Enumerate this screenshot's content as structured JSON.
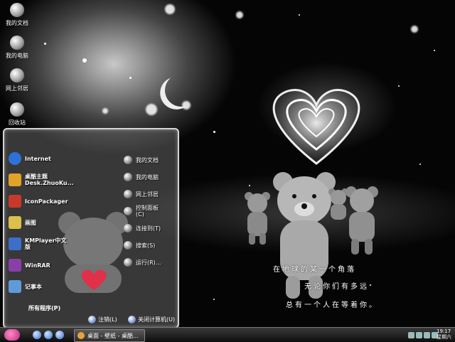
{
  "desktop": {
    "icons": [
      {
        "label": "我的文档",
        "icon": "documents-icon"
      },
      {
        "label": "我的电脑",
        "icon": "computer-icon"
      },
      {
        "label": "网上邻居",
        "icon": "network-icon"
      },
      {
        "label": "回收站",
        "icon": "recycle-bin-icon"
      }
    ],
    "wallpaper_text": [
      "在地球的某一个角落",
      "无论你们有多远",
      "总有一个人在等着你。"
    ]
  },
  "start_menu": {
    "left_items": [
      {
        "label": "Internet",
        "icon": "ie-icon",
        "color": "#2d72d8"
      },
      {
        "label": "桌酷主题\nDesk.ZhuoKu...",
        "icon": "theme-icon",
        "color": "#e2a227"
      },
      {
        "label": "IconPackager",
        "icon": "iconpackager-icon",
        "color": "#c73a2a"
      },
      {
        "label": "画图",
        "icon": "paint-icon",
        "color": "#d9c14a"
      },
      {
        "label": "KMPlayer中文\n版",
        "icon": "kmplayer-icon",
        "color": "#3b6fc9"
      },
      {
        "label": "WinRAR",
        "icon": "winrar-icon",
        "color": "#8a3fa8"
      },
      {
        "label": "记事本",
        "icon": "notepad-icon",
        "color": "#5f9bd8"
      }
    ],
    "right_items": [
      {
        "label": "我的文档",
        "icon": "documents-icon"
      },
      {
        "label": "我的电脑",
        "icon": "computer-icon"
      },
      {
        "label": "网上邻居",
        "icon": "network-icon"
      },
      {
        "label": "控制面板\n(C)",
        "icon": "control-panel-icon"
      },
      {
        "label": "连接到(T)",
        "icon": "connect-icon"
      },
      {
        "label": "搜索(S)",
        "icon": "search-icon"
      },
      {
        "label": "运行(R)...",
        "icon": "run-icon"
      }
    ],
    "all_programs": "所有程序(P)",
    "logoff": "注销(L)",
    "shutdown": "关闭计算机(U)"
  },
  "taskbar": {
    "task_label": "桌面 - 壁纸 - 桌酷...",
    "clock_time": "19:17",
    "clock_day": "星期六"
  }
}
